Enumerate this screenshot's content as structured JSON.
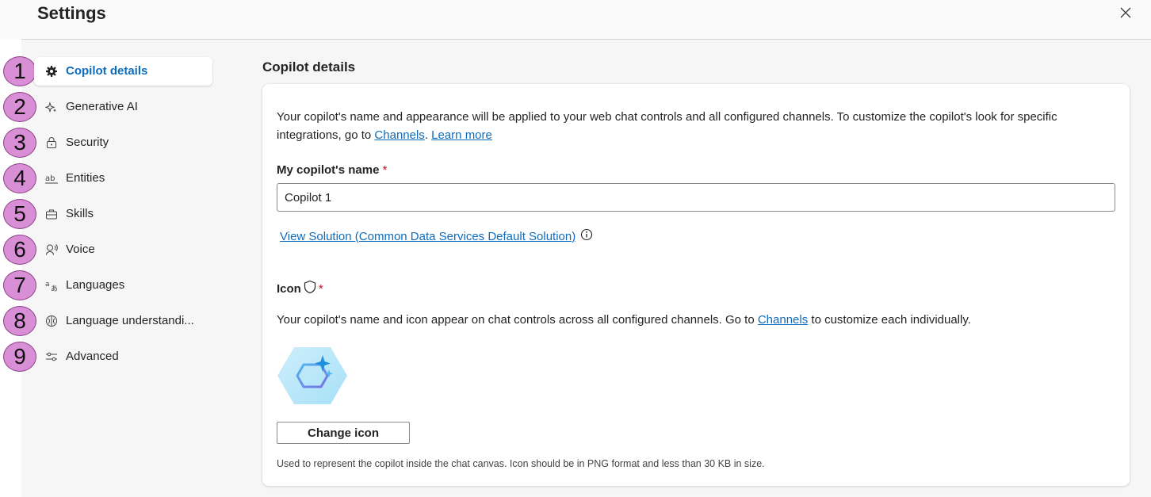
{
  "header": {
    "title": "Settings"
  },
  "badges": [
    "1",
    "2",
    "3",
    "4",
    "5",
    "6",
    "7",
    "8",
    "9"
  ],
  "sidebar": {
    "items": [
      {
        "label": "Copilot details",
        "icon": "gear-icon",
        "active": true
      },
      {
        "label": "Generative AI",
        "icon": "sparkle-icon"
      },
      {
        "label": "Security",
        "icon": "lock-icon"
      },
      {
        "label": "Entities",
        "icon": "ab-text-icon"
      },
      {
        "label": "Skills",
        "icon": "toolbox-icon"
      },
      {
        "label": "Voice",
        "icon": "voice-icon"
      },
      {
        "label": "Languages",
        "icon": "translate-icon"
      },
      {
        "label": "Language understandi...",
        "icon": "brain-icon"
      },
      {
        "label": "Advanced",
        "icon": "sliders-icon"
      }
    ]
  },
  "main": {
    "title": "Copilot details",
    "intro_text": "Your copilot's name and appearance will be applied to your web chat controls and all configured channels. To customize the copilot's look for specific integrations, go to ",
    "intro_channels_link": "Channels",
    "intro_period": ".",
    "intro_learn_more": "Learn more",
    "name_label": "My copilot's name",
    "required_mark": "*",
    "name_value": "Copilot 1",
    "solution_link": "View Solution (Common Data Services Default Solution)",
    "icon_label": "Icon",
    "icon_desc_before": "Your copilot's name and icon appear on chat controls across all configured channels. Go to ",
    "icon_desc_link": "Channels",
    "icon_desc_after": " to customize each individually.",
    "change_icon_button": "Change icon",
    "help_text": "Used to represent the copilot inside the chat canvas. Icon should be in PNG format and less than 30 KB in size."
  },
  "colors": {
    "accent": "#0f6cbd",
    "badge": "#d98fd6",
    "required": "#c50f1f"
  }
}
